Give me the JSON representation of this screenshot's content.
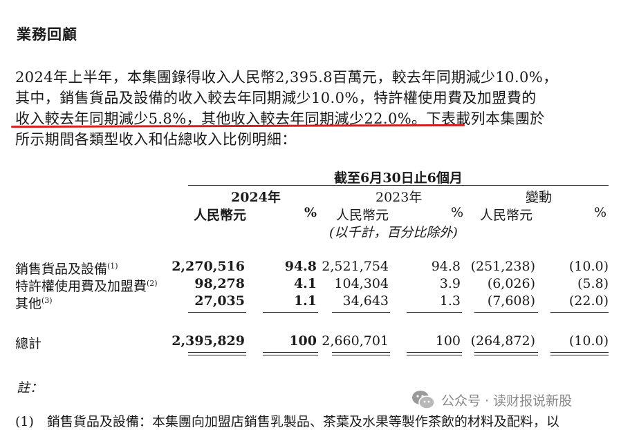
{
  "heading": "業務回顧",
  "paragraph": [
    "2024年上半年，本集團錄得收入人民幣2,395.8百萬元，較去年同期減少10.0%，",
    "其中，銷售貨品及設備的收入較去年同期減少10.0%，特許權使用費及加盟費的",
    "收入較去年同期減少5.8%，其他收入較去年同期減少22.0%。下表載列本集團於",
    "所示期間各類型收入和佔總收入比例明細："
  ],
  "table": {
    "period_header": "截至6月30日止6個月",
    "year_2024": "2024年",
    "year_2023": "2023年",
    "change_header": "變動",
    "rmb": "人民幣元",
    "pct": "%",
    "unit_note": "(以千計，百分比除外)",
    "rows": [
      {
        "label": "銷售貨品及設備",
        "note": "(1)",
        "v2024": "2,270,516",
        "p2024": "94.8",
        "v2023": "2,521,754",
        "p2023": "94.8",
        "chg": "(251,238)",
        "chgp": "(10.0)"
      },
      {
        "label": "特許權使用費及加盟費",
        "note": "(2)",
        "v2024": "98,278",
        "p2024": "4.1",
        "v2023": "104,304",
        "p2023": "3.9",
        "chg": "(6,026)",
        "chgp": "(5.8)"
      },
      {
        "label": "其他",
        "note": "(3)",
        "v2024": "27,035",
        "p2024": "1.1",
        "v2023": "34,643",
        "p2023": "1.3",
        "chg": "(7,608)",
        "chgp": "(22.0)"
      }
    ],
    "total": {
      "label": "總計",
      "v2024": "2,395,829",
      "p2024": "100",
      "v2023": "2,660,701",
      "p2023": "100",
      "chg": "(264,872)",
      "chgp": "(10.0)"
    }
  },
  "notes_label": "註：",
  "footnote_partial": "(1)　銷售貨品及設備：本集團向加盟店銷售乳製品、茶葉及水果等製作茶飲的材料及配料，以",
  "watermark": "公众号 · 读财报说新股",
  "colors": {
    "underline": "#d62020",
    "text": "#1a1a1a",
    "watermark": "#8a8a8a"
  }
}
